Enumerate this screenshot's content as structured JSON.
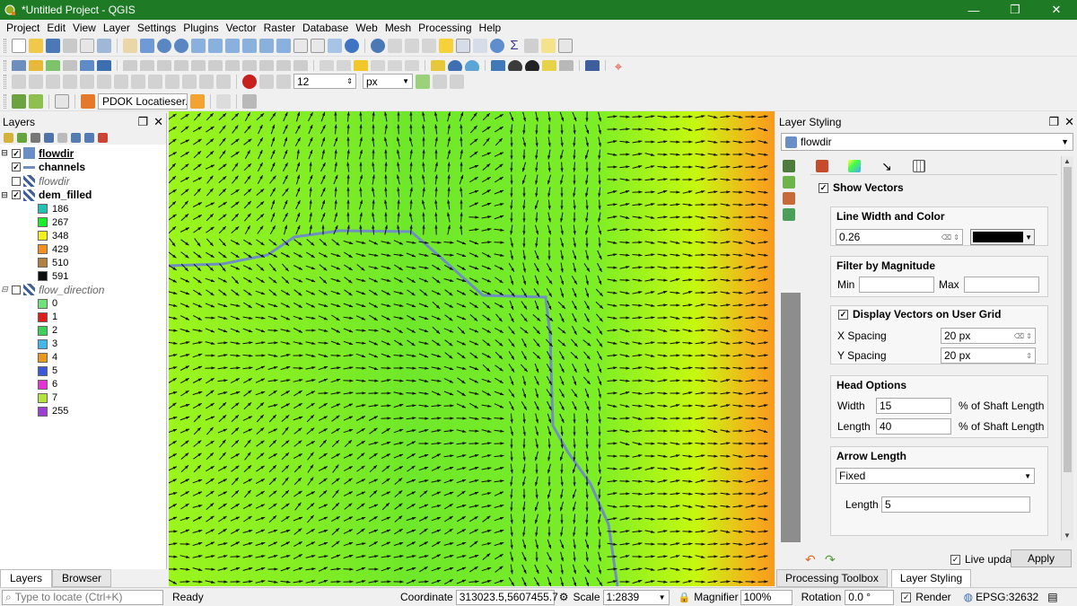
{
  "window": {
    "title": "*Untitled Project - QGIS",
    "min": "—",
    "max": "❐",
    "close": "✕"
  },
  "menu": [
    "Project",
    "Edit",
    "View",
    "Layer",
    "Settings",
    "Plugins",
    "Vector",
    "Raster",
    "Database",
    "Web",
    "Mesh",
    "Processing",
    "Help"
  ],
  "toolbar3": {
    "spin_value": "12",
    "unit_value": "px"
  },
  "toolbar4": {
    "locator_text": "PDOK Locatieser..."
  },
  "layers_panel": {
    "title": "Layers",
    "tree": [
      {
        "label": "flowdir",
        "style": "bold",
        "checked": true,
        "expanded": true
      },
      {
        "label": "channels",
        "style": "bold",
        "checked": true,
        "expanded": false
      },
      {
        "label": "flowdir",
        "style": "italic",
        "checked": false,
        "expanded": false
      },
      {
        "label": "dem_filled",
        "style": "bold",
        "checked": true,
        "expanded": true
      }
    ],
    "dem_legend": [
      {
        "label": "186",
        "color": "#1fc3b1"
      },
      {
        "label": "267",
        "color": "#19ef2a"
      },
      {
        "label": "348",
        "color": "#f2f01f"
      },
      {
        "label": "429",
        "color": "#f5901e"
      },
      {
        "label": "510",
        "color": "#b0803f"
      },
      {
        "label": "591",
        "color": "#0e0e0e"
      }
    ],
    "flow_layer": {
      "label": "flow_direction",
      "style": "italic"
    },
    "flow_legend": [
      {
        "label": "0",
        "color": "#6fe27a"
      },
      {
        "label": "1",
        "color": "#e01b1b"
      },
      {
        "label": "2",
        "color": "#3ed157"
      },
      {
        "label": "3",
        "color": "#43b7e8"
      },
      {
        "label": "4",
        "color": "#e79a1d"
      },
      {
        "label": "5",
        "color": "#3a5ad8"
      },
      {
        "label": "6",
        "color": "#e534d6"
      },
      {
        "label": "7",
        "color": "#b4e339"
      },
      {
        "label": "255",
        "color": "#9d3fd0"
      }
    ],
    "tabs": [
      "Layers",
      "Browser"
    ]
  },
  "styling": {
    "title": "Layer Styling",
    "layer": "flowdir",
    "show_vectors": "Show Vectors",
    "line_group": "Line Width and Color",
    "line_width": "0.26",
    "filter_group": "Filter by Magnitude",
    "min_label": "Min",
    "max_label": "Max",
    "grid_group": "Display Vectors on User Grid",
    "xspacing_label": "X Spacing",
    "xspacing_value": "20 px",
    "yspacing_label": "Y Spacing",
    "yspacing_value": "20 px",
    "head_group": "Head Options",
    "width_label": "Width",
    "width_value": "15",
    "length_label": "Length",
    "length_value": "40",
    "pct_label": "% of Shaft Length",
    "arrow_group": "Arrow Length",
    "arrow_mode": "Fixed",
    "arrow_length_label": "Length",
    "arrow_length_value": "5",
    "live_update": "Live update",
    "apply": "Apply",
    "dock_tabs": [
      "Processing Toolbox",
      "Layer Styling"
    ]
  },
  "statusbar": {
    "locate_placeholder": "Type to locate (Ctrl+K)",
    "ready": "Ready",
    "coord_label": "Coordinate",
    "coord_value": "313023.5,5607455.7",
    "scale_label": "Scale",
    "scale_value": "1:2839",
    "magnifier_label": "Magnifier",
    "magnifier_value": "100%",
    "rotation_label": "Rotation",
    "rotation_value": "0.0 °",
    "render_label": "Render",
    "crs": "EPSG:32632"
  },
  "colors": {
    "titlebar": "#1f7a26",
    "channel": "#6f8fc0",
    "arrow": "#111111"
  }
}
